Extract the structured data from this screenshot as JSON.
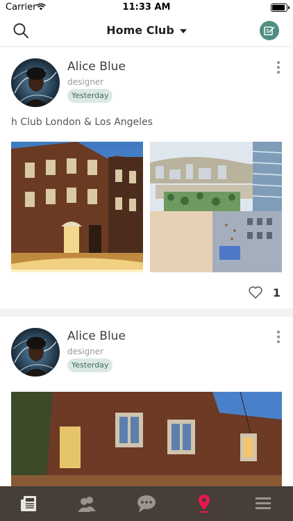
{
  "status_bar": {
    "carrier": "Carrier",
    "time": "11:33 AM",
    "battery_level": 0.9
  },
  "nav": {
    "title": "Home Club",
    "search_icon": "search-icon",
    "compose_icon": "compose-icon",
    "accent": "#4f8f82"
  },
  "posts": [
    {
      "author": "Alice Blue",
      "role": "designer",
      "time": "Yesterday",
      "caption": "h Club London & Los Angeles",
      "likes": "1"
    },
    {
      "author": "Alice Blue",
      "role": "designer",
      "time": "Yesterday"
    }
  ],
  "tabbar": {
    "background": "#463e37",
    "active_color": "#e8184f",
    "tabs": [
      "news-icon",
      "members-icon",
      "chat-icon",
      "location-pin-icon",
      "menu-icon"
    ],
    "active_tab": "location-pin-icon"
  }
}
